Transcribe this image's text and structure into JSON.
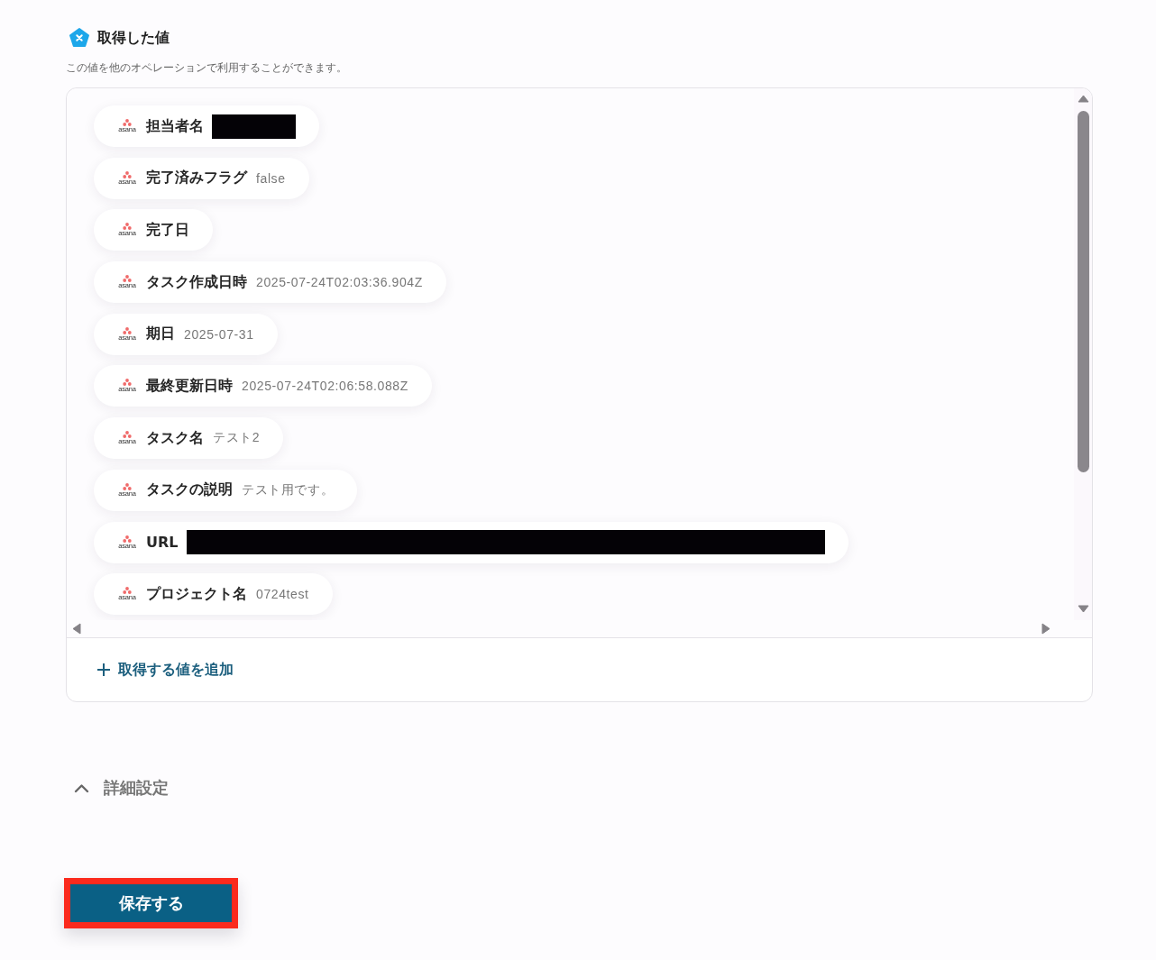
{
  "section": {
    "title": "取得した値",
    "description": "この値を他のオペレーションで利用することができます。"
  },
  "values": [
    {
      "app": "asana",
      "label": "担当者名",
      "kind": "masked-short"
    },
    {
      "app": "asana",
      "label": "完了済みフラグ",
      "kind": "value",
      "value": "false"
    },
    {
      "app": "asana",
      "label": "完了日",
      "kind": "empty"
    },
    {
      "app": "asana",
      "label": "タスク作成日時",
      "kind": "value",
      "value": "2025-07-24T02:03:36.904Z"
    },
    {
      "app": "asana",
      "label": "期日",
      "kind": "value",
      "value": "2025-07-31"
    },
    {
      "app": "asana",
      "label": "最終更新日時",
      "kind": "value",
      "value": "2025-07-24T02:06:58.088Z"
    },
    {
      "app": "asana",
      "label": "タスク名",
      "kind": "value",
      "value": "テスト2"
    },
    {
      "app": "asana",
      "label": "タスクの説明",
      "kind": "value",
      "value": "テスト用です。"
    },
    {
      "app": "asana",
      "label": "URL",
      "kind": "masked-long"
    },
    {
      "app": "asana",
      "label": "プロジェクト名",
      "kind": "value",
      "value": "0724test"
    }
  ],
  "add_link": {
    "label": "取得する値を追加"
  },
  "details": {
    "label": "詳細設定"
  },
  "save_button": {
    "label": "保存する",
    "highlighted": true
  }
}
